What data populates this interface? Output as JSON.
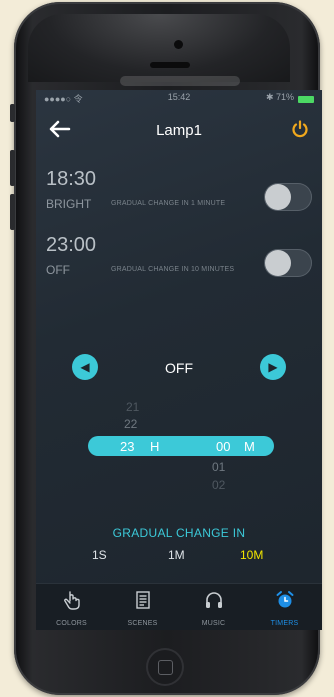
{
  "status": {
    "left": "●●●●○ 令",
    "time": "15:42",
    "right": "✱ 71%"
  },
  "navbar": {
    "title": "Lamp1",
    "back_icon": "back-arrow-icon",
    "power_icon": "power-icon"
  },
  "timers": [
    {
      "time": "18:30",
      "mode": "BRIGHT",
      "desc": "GRADUAL CHANGE IN 1 MINUTE",
      "enabled": false
    },
    {
      "time": "23:00",
      "mode": "OFF",
      "desc": "GRADUAL CHANGE IN 10 MINUTES",
      "enabled": false
    }
  ],
  "selector": {
    "value": "OFF",
    "prev_icon": "chevron-left-icon",
    "next_icon": "chevron-right-icon"
  },
  "picker": {
    "hours_above": [
      "21",
      "22"
    ],
    "hour": "23",
    "hour_unit": "H",
    "minute": "00",
    "minute_unit": "M",
    "minutes_below": [
      "01",
      "02"
    ]
  },
  "gradual": {
    "title": "GRADUAL CHANGE IN",
    "options": [
      "1S",
      "1M",
      "10M"
    ],
    "selected": "10M"
  },
  "tabs": [
    {
      "label": "COLORS",
      "icon": "hand-pointer-icon"
    },
    {
      "label": "SCENES",
      "icon": "document-list-icon"
    },
    {
      "label": "MUSIC",
      "icon": "headphones-icon"
    },
    {
      "label": "TIMERS",
      "icon": "alarm-clock-icon",
      "active": true
    }
  ],
  "colors": {
    "accent": "#3cc9d8",
    "power": "#f0a81d",
    "selected": "#f2e500",
    "active_tab": "#1e8fe6"
  }
}
